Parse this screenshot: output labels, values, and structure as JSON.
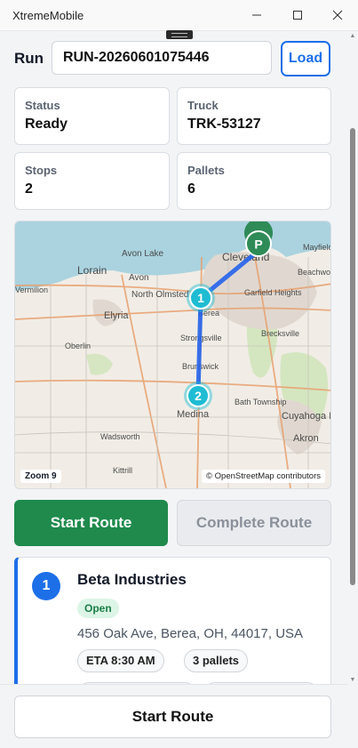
{
  "app": {
    "title": "XtremeMobile"
  },
  "run": {
    "label": "Run",
    "value": "RUN-20260601075446",
    "load_label": "Load"
  },
  "summary": {
    "status": {
      "label": "Status",
      "value": "Ready"
    },
    "truck": {
      "label": "Truck",
      "value": "TRK-53127"
    },
    "stops": {
      "label": "Stops",
      "value": "2"
    },
    "pallets": {
      "label": "Pallets",
      "value": "6"
    }
  },
  "map": {
    "zoom_label": "Zoom 9",
    "attribution": "© OpenStreetMap contributors",
    "places": [
      "Avon Lake",
      "Lorain",
      "Avon",
      "North Olmsted",
      "Cleveland",
      "Mayfield Heights",
      "Beachwood",
      "Garfield Heights",
      "Vermilion",
      "Elyria",
      "Berea",
      "Oberlin",
      "Strongsville",
      "Brecksville",
      "Brunswick",
      "Bath Township",
      "Medina",
      "Cuyahoga Falls",
      "Akron",
      "Wadsworth",
      "Kittrill"
    ],
    "markers": [
      {
        "label": "P",
        "color": "#2e8b57",
        "name": "origin-pin"
      },
      {
        "label": "1",
        "color": "#1fbcd3",
        "name": "stop-marker-1"
      },
      {
        "label": "2",
        "color": "#1fbcd3",
        "name": "stop-marker-2"
      }
    ],
    "route_color": "#2563eb"
  },
  "actions": {
    "start_label": "Start Route",
    "complete_label": "Complete Route"
  },
  "stops": [
    {
      "number": "1",
      "name": "Beta Industries",
      "status": "Open",
      "address": "456 Oak Ave, Berea, OH, 44017, USA",
      "eta": "ETA 8:30 AM",
      "pallets": "3 pallets"
    }
  ],
  "footer": {
    "start_label": "Start Route"
  }
}
